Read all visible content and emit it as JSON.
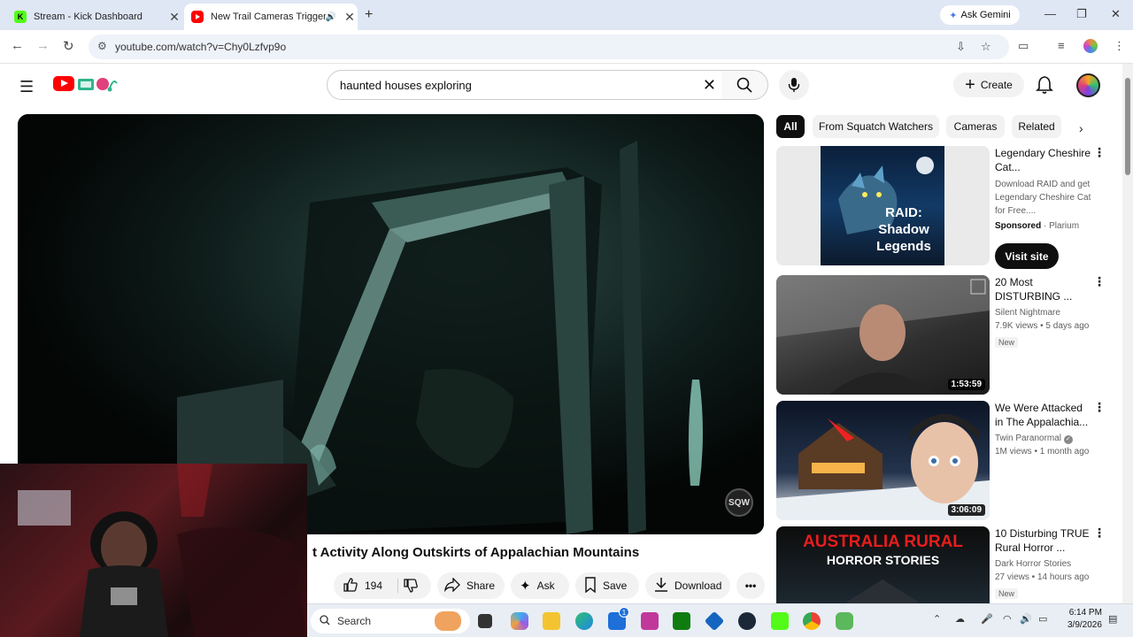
{
  "browser": {
    "tabs": [
      {
        "title": "Stream - Kick Dashboard",
        "favicon": "K",
        "favicon_color": "#53fc18"
      },
      {
        "title": "New Trail Cameras Trigger I",
        "favicon_color": "#ff0000",
        "active": true
      }
    ],
    "gemini_label": "Ask Gemini",
    "url": "youtube.com/watch?v=Chy0Lzfvp9o"
  },
  "youtube": {
    "search_query": "haunted houses exploring",
    "create_label": "Create"
  },
  "video": {
    "title": "t Activity Along Outskirts of Appalachian Mountains",
    "watermark": "SQW",
    "likes": "194",
    "share_label": "Share",
    "ask_label": "Ask",
    "save_label": "Save",
    "download_label": "Download"
  },
  "chips": [
    "All",
    "From Squatch Watchers",
    "Cameras",
    "Related"
  ],
  "recommendations": [
    {
      "title": "Legendary Cheshire Cat...",
      "description": "Download RAID and get Legendary Cheshire Cat for Free....",
      "sponsored": "Sponsored",
      "advertiser": "Plarium",
      "cta": "Visit site",
      "thumb_text": "RAID: Shadow Legends"
    },
    {
      "title": "20 Most DISTURBING ...",
      "channel": "Silent Nightmare",
      "views": "7.9K views",
      "age": "5 days ago",
      "badge": "New",
      "duration": "1:53:59"
    },
    {
      "title": "We Were Attacked in The Appalachia...",
      "channel": "Twin Paranormal",
      "verified": true,
      "views": "1M views",
      "age": "1 month ago",
      "duration": "3:06:09"
    },
    {
      "title": "10 Disturbing TRUE Rural Horror ...",
      "channel": "Dark Horror Stories",
      "views": "27 views",
      "age": "14 hours ago",
      "badge": "New",
      "thumb_text": "AUSTRALIA RURAL",
      "thumb_sub": "HORROR STORIES"
    }
  ],
  "taskbar": {
    "search_placeholder": "Search",
    "time": "6:14 PM",
    "date": "3/9/2026",
    "notification_count": "1"
  }
}
